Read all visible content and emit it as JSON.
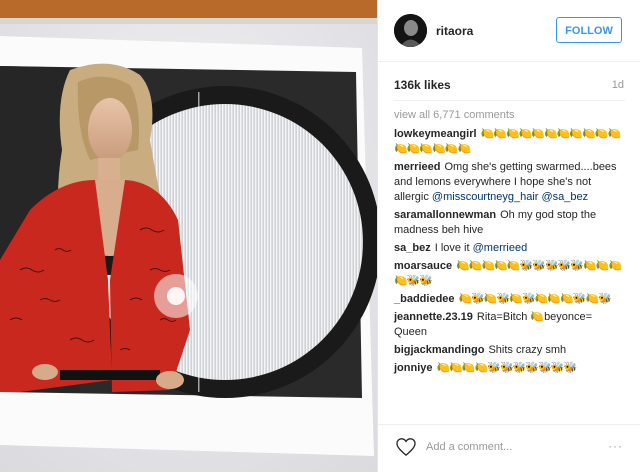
{
  "post": {
    "username": "ritaora",
    "follow_label": "FOLLOW",
    "likes": "136k likes",
    "time": "1d",
    "view_all": "view all 6,771 comments",
    "add_comment_placeholder": "Add a comment...",
    "more_label": "···"
  },
  "comments": [
    {
      "user": "lowkeymeangirl",
      "text": "🍋🍋🍋🍋🍋🍋🍋🍋🍋🍋🍋🍋🍋🍋🍋🍋🍋"
    },
    {
      "user": "merrieed",
      "text": "Omg she's getting swarmed....bees and lemons everywhere I hope she's not allergic",
      "mention": "@misscourtneyg_hair @sa_bez"
    },
    {
      "user": "saramallonnewman",
      "text": "Oh my god stop the madness beh hive"
    },
    {
      "user": "sa_bez",
      "text": "I love it",
      "mention": "@merrieed"
    },
    {
      "user": "moarsauce",
      "text": "🍋🍋🍋🍋🍋🐝🐝🐝🐝🐝🍋🍋🍋🍋🐝🐝"
    },
    {
      "user": "_baddiedee",
      "text": "🍋🐝🍋🐝🍋🐝🍋🍋🍋🐝🍋🐝"
    },
    {
      "user": "jeannette.23.19",
      "text": "Rita=Bitch 🍋beyonce= Queen"
    },
    {
      "user": "bigjackmandingo",
      "text": "Shits crazy smh"
    },
    {
      "user": "jonniye",
      "text": "🍋🍋🍋🍋🐝🐝🐝🐝🐝🐝🐝"
    }
  ],
  "colors": {
    "accent": "#3897f0",
    "shirt": "#c8281e"
  },
  "icons": {
    "heart": "heart-icon",
    "more": "more-options-icon"
  }
}
